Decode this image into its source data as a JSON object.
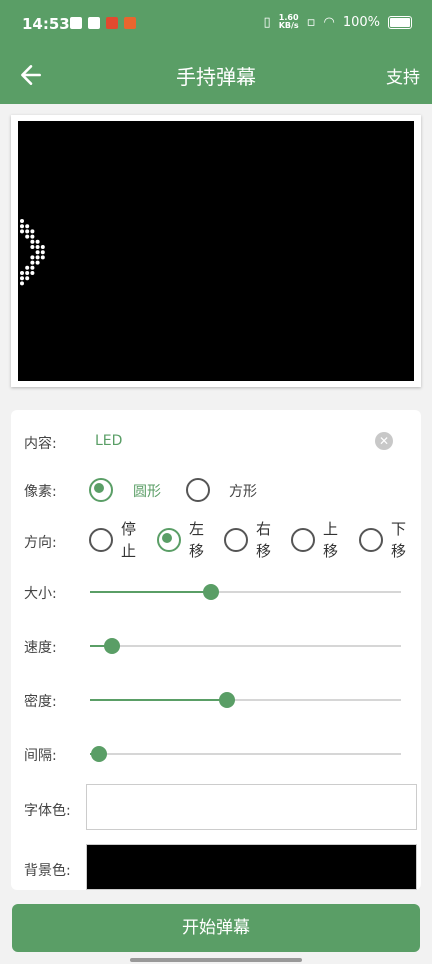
{
  "status_bar": {
    "time": "14:53",
    "speed_top": "1.60",
    "speed_bottom": "KB/s",
    "battery": "100%"
  },
  "appbar": {
    "back_icon": "arrow-left-icon",
    "title": "手持弹幕",
    "support": "支持"
  },
  "preview": {
    "led_text": "LED",
    "background": "#000000",
    "dot_color": "#ffffff"
  },
  "form": {
    "content": {
      "label": "内容:",
      "value": "LED"
    },
    "pixel": {
      "label": "像素:",
      "options": [
        {
          "label": "圆形",
          "selected": true
        },
        {
          "label": "方形",
          "selected": false
        }
      ]
    },
    "direction": {
      "label": "方向:",
      "options": [
        {
          "label": "停止",
          "selected": false
        },
        {
          "label": "左移",
          "selected": true
        },
        {
          "label": "右移",
          "selected": false
        },
        {
          "label": "上移",
          "selected": false
        },
        {
          "label": "下移",
          "selected": false
        }
      ]
    },
    "size": {
      "label": "大小:",
      "value": 0.39
    },
    "speed": {
      "label": "速度:",
      "value": 0.07
    },
    "density": {
      "label": "密度:",
      "value": 0.44
    },
    "interval": {
      "label": "间隔:",
      "value": 0.03
    },
    "font_color": {
      "label": "字体色:",
      "value": "#ffffff"
    },
    "bg_color": {
      "label": "背景色:",
      "value": "#000000"
    }
  },
  "start_button": "开始弹幕",
  "accent_color": "#5a9e66"
}
